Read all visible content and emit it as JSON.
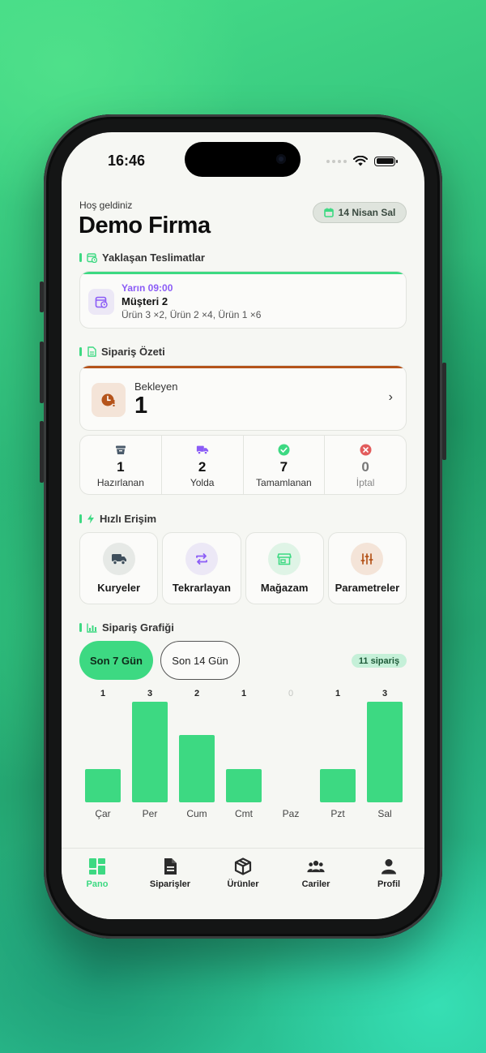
{
  "status_bar": {
    "time": "16:46"
  },
  "header": {
    "welcome": "Hoş geldiniz",
    "company": "Demo Firma",
    "date": "14 Nisan Sal"
  },
  "sections": {
    "deliveries": "Yaklaşan Teslimatlar",
    "order_summary": "Sipariş Özeti",
    "quick_access": "Hızlı Erişim",
    "order_chart": "Sipariş Grafiği"
  },
  "delivery": {
    "when": "Yarın 09:00",
    "customer": "Müşteri 2",
    "items": "Ürün 3 ×2, Ürün 2 ×4, Ürün 1 ×6"
  },
  "pending": {
    "label": "Bekleyen",
    "count": "1",
    "chevron": "›"
  },
  "stats": [
    {
      "count": "1",
      "label": "Hazırlanan",
      "icon": "basket-icon",
      "color": "#4a5a6a"
    },
    {
      "count": "2",
      "label": "Yolda",
      "icon": "truck-icon",
      "color": "#8b5cf6"
    },
    {
      "count": "7",
      "label": "Tamamlanan",
      "icon": "check-circle-icon",
      "color": "#3dd982"
    },
    {
      "count": "0",
      "label": "İptal",
      "icon": "x-circle-icon",
      "color": "#e25c5c"
    }
  ],
  "quick": [
    {
      "label": "Kuryeler",
      "icon": "truck-icon",
      "bg": "#e6e9e6",
      "color": "#3f4f5c"
    },
    {
      "label": "Tekrarlayan",
      "icon": "repeat-icon",
      "bg": "#ece8f6",
      "color": "#8b5cf6"
    },
    {
      "label": "Mağazam",
      "icon": "store-icon",
      "bg": "#dff4e6",
      "color": "#3dd982"
    },
    {
      "label": "Parametreler",
      "icon": "sliders-icon",
      "bg": "#f4e4d8",
      "color": "#b5541b"
    }
  ],
  "chart_controls": {
    "range_7": "Son 7 Gün",
    "range_14": "Son 14 Gün",
    "total": "11 sipariş"
  },
  "chart_data": {
    "type": "bar",
    "categories": [
      "Çar",
      "Per",
      "Cum",
      "Cmt",
      "Paz",
      "Pzt",
      "Sal"
    ],
    "values": [
      1,
      3,
      2,
      1,
      0,
      1,
      3
    ],
    "ylim": [
      0,
      3
    ],
    "color": "#3dd982"
  },
  "tabs": [
    {
      "label": "Pano",
      "icon": "dashboard-icon",
      "active": true
    },
    {
      "label": "Siparişler",
      "icon": "document-icon",
      "active": false
    },
    {
      "label": "Ürünler",
      "icon": "box-icon",
      "active": false
    },
    {
      "label": "Cariler",
      "icon": "users-icon",
      "active": false
    },
    {
      "label": "Profil",
      "icon": "person-icon",
      "active": false
    }
  ],
  "colors": {
    "accent": "#3dd982",
    "pending": "#b5541b",
    "purple": "#8b5cf6"
  }
}
